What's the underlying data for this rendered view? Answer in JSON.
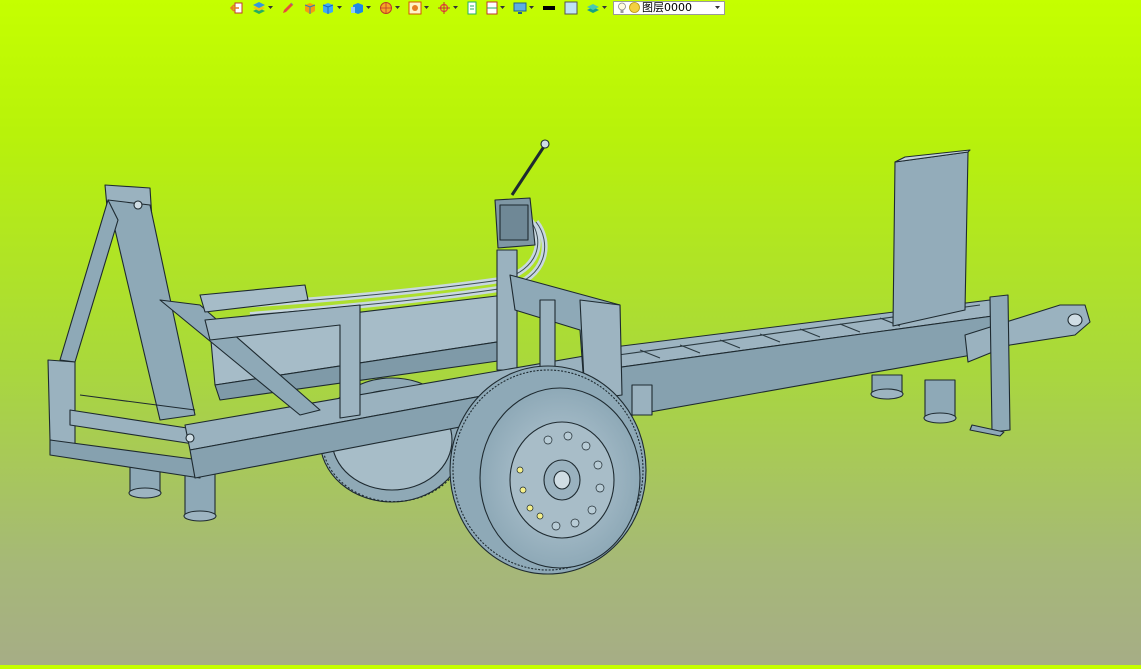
{
  "toolbar": {
    "buttons": [
      {
        "icon": "exit-icon",
        "has_dropdown": false
      },
      {
        "icon": "layers-stack-icon",
        "has_dropdown": true
      },
      {
        "icon": "pencil-icon",
        "has_dropdown": false
      },
      {
        "icon": "solid-box-icon",
        "has_dropdown": false
      },
      {
        "icon": "blue-cube-icon",
        "has_dropdown": true
      },
      {
        "icon": "cube-copy-icon",
        "has_dropdown": true
      },
      {
        "icon": "orange-sphere-icon",
        "has_dropdown": true
      },
      {
        "icon": "shape-frame-icon",
        "has_dropdown": true
      },
      {
        "icon": "crosshair-icon",
        "has_dropdown": true
      },
      {
        "icon": "page-icon",
        "has_dropdown": false
      },
      {
        "icon": "page-split-icon",
        "has_dropdown": true
      },
      {
        "icon": "display-icon",
        "has_dropdown": true
      },
      {
        "icon": "line-color-icon",
        "has_dropdown": false
      },
      {
        "icon": "fill-color-icon",
        "has_dropdown": false
      },
      {
        "icon": "layer-stack-icon",
        "has_dropdown": true
      }
    ],
    "layer_selector": {
      "value": "图层0000",
      "icons": [
        "lightbulb-icon",
        "layer-dot-icon"
      ]
    }
  },
  "viewport": {
    "model": "log-splitter-trailer-3d-model",
    "background_top": "#c5ff00",
    "background_bottom": "#a6ad86",
    "model_color": "#8ea9b7"
  }
}
